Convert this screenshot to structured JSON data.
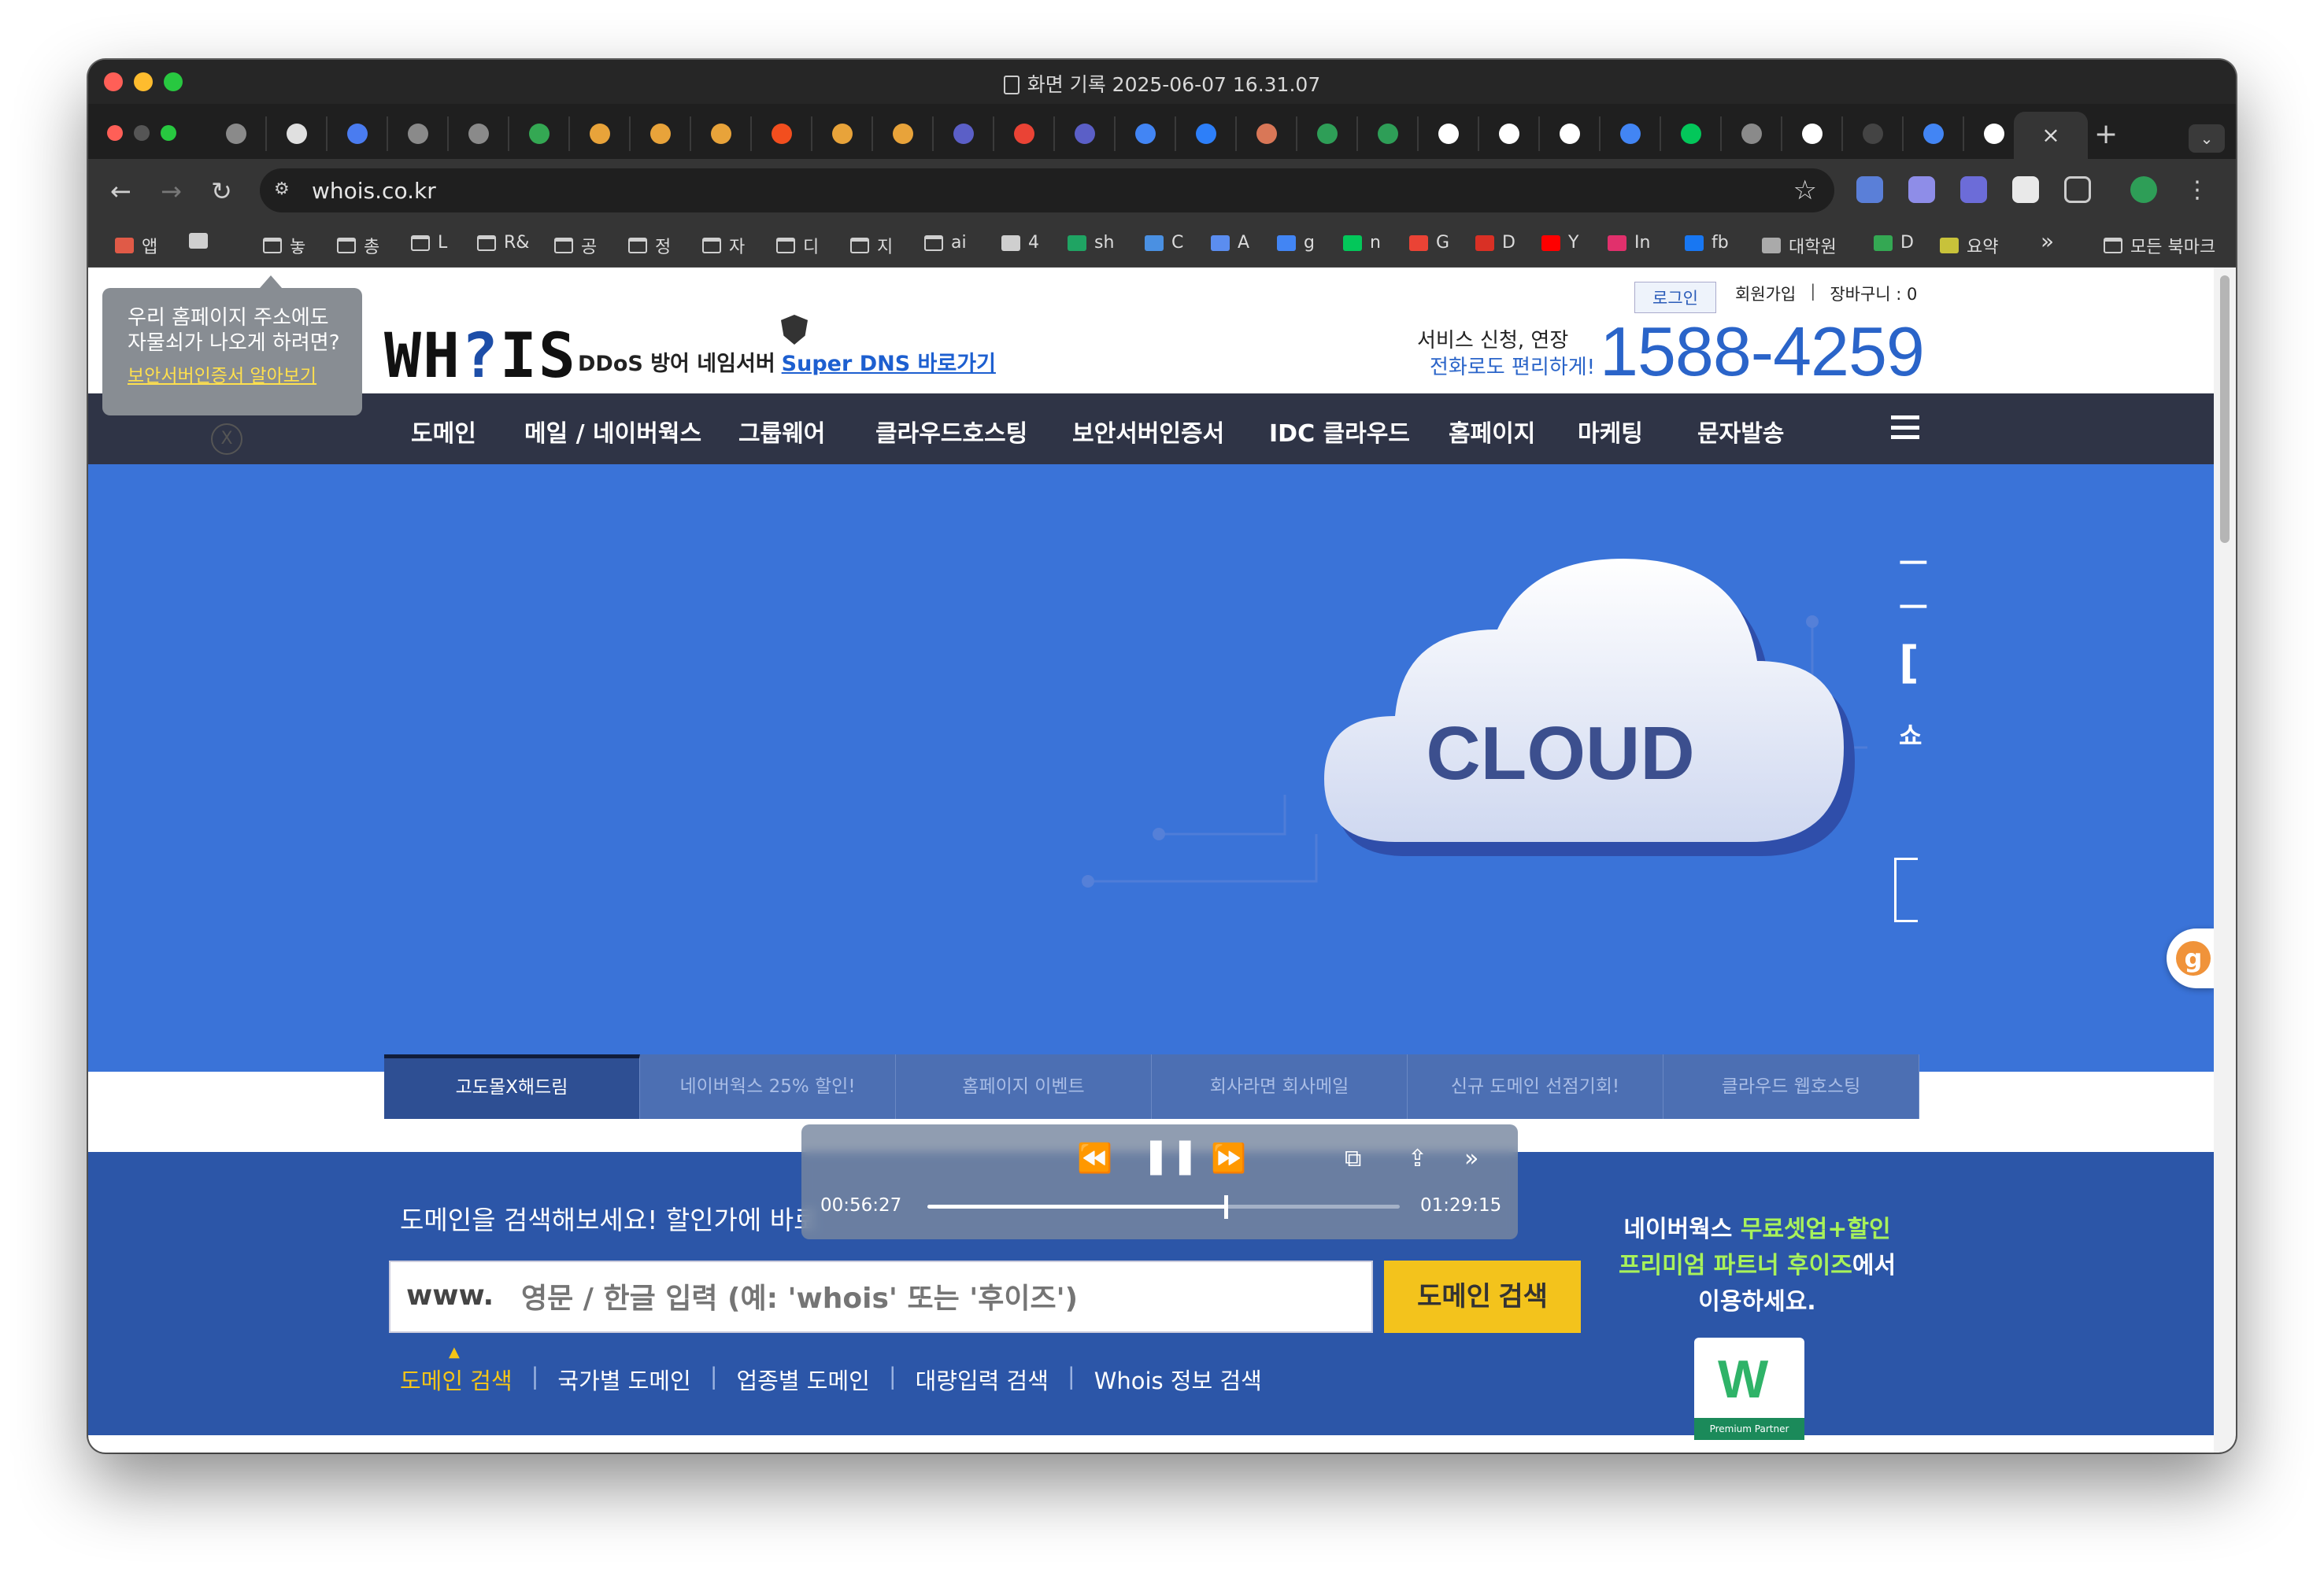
{
  "window": {
    "title": "화면 기록 2025-06-07 16.31.07"
  },
  "tabs": {
    "favicons": [
      {
        "icon": "globe-icon",
        "color": "#8a8a8a"
      },
      {
        "icon": "openai-icon",
        "color": "#e0e0e0"
      },
      {
        "icon": "ring-icon",
        "color": "#4a7cf0"
      },
      {
        "icon": "globe-icon",
        "color": "#8a8a8a"
      },
      {
        "icon": "globe-icon",
        "color": "#8a8a8a"
      },
      {
        "icon": "google-drive-icon",
        "color": "#34a853"
      },
      {
        "icon": "infinity-icon",
        "color": "#e8a33a"
      },
      {
        "icon": "infinity-icon",
        "color": "#e8a33a"
      },
      {
        "icon": "infinity-icon",
        "color": "#e8a33a"
      },
      {
        "icon": "figma-icon",
        "color": "#f24e1e"
      },
      {
        "icon": "infinity-icon",
        "color": "#e8a33a"
      },
      {
        "icon": "infinity-icon",
        "color": "#e8a33a"
      },
      {
        "icon": "slack-icon",
        "color": "#5b5fc7"
      },
      {
        "icon": "gmail-icon",
        "color": "#ea4335"
      },
      {
        "icon": "slack-icon",
        "color": "#5b5fc7"
      },
      {
        "icon": "google-icon",
        "color": "#4285f4"
      },
      {
        "icon": "butterfly-icon",
        "color": "#2d7ff9"
      },
      {
        "icon": "sparkle-icon",
        "color": "#d97757"
      },
      {
        "icon": "leaf-icon",
        "color": "#2e9e57"
      },
      {
        "icon": "leaf-icon",
        "color": "#2e9e57"
      },
      {
        "icon": "github-icon",
        "color": "#ffffff"
      },
      {
        "icon": "github-icon",
        "color": "#ffffff"
      },
      {
        "icon": "cursor-icon",
        "color": "#ffffff"
      },
      {
        "icon": "google-icon",
        "color": "#4285f4"
      },
      {
        "icon": "naver-icon",
        "color": "#03c75a"
      },
      {
        "icon": "globe-icon",
        "color": "#8a8a8a"
      },
      {
        "icon": "vercel-icon",
        "color": "#ffffff"
      },
      {
        "icon": "loading-icon",
        "color": "#444444"
      },
      {
        "icon": "google-icon",
        "color": "#4285f4"
      },
      {
        "icon": "github-icon",
        "color": "#ffffff"
      }
    ],
    "active_close": "×",
    "new_tab": "+"
  },
  "toolbar": {
    "back": "←",
    "forward": "→",
    "reload": "↻",
    "url": "whois.co.kr",
    "star": "☆"
  },
  "bookmarks": [
    {
      "label": "앱",
      "icon": "apps-icon"
    },
    {
      "label": "",
      "icon": "grid-icon"
    },
    {
      "label": "놓",
      "icon": "folder-icon"
    },
    {
      "label": "총",
      "icon": "folder-icon"
    },
    {
      "label": "L",
      "icon": "folder-icon"
    },
    {
      "label": "R&",
      "icon": "folder-icon"
    },
    {
      "label": "공",
      "icon": "folder-icon"
    },
    {
      "label": "정",
      "icon": "folder-icon"
    },
    {
      "label": "자",
      "icon": "folder-icon"
    },
    {
      "label": "디",
      "icon": "folder-icon"
    },
    {
      "label": "지",
      "icon": "folder-icon"
    },
    {
      "label": "ai",
      "icon": "folder-icon"
    },
    {
      "label": "4",
      "icon": "openai-icon"
    },
    {
      "label": "sh",
      "icon": "sheets-icon"
    },
    {
      "label": "C",
      "icon": "image-icon"
    },
    {
      "label": "A",
      "icon": "a-icon"
    },
    {
      "label": "g",
      "icon": "google-icon"
    },
    {
      "label": "n",
      "icon": "naver-icon"
    },
    {
      "label": "G",
      "icon": "gmail-icon"
    },
    {
      "label": "D",
      "icon": "calendar-icon"
    },
    {
      "label": "Y",
      "icon": "youtube-icon"
    },
    {
      "label": "In",
      "icon": "instagram-icon"
    },
    {
      "label": "fb",
      "icon": "facebook-icon"
    },
    {
      "label": "대학원",
      "icon": "globe-icon"
    },
    {
      "label": "D",
      "icon": "google-drive-icon"
    },
    {
      "label": "요약",
      "icon": "summary-icon"
    }
  ],
  "bookmarks_more": "»",
  "bookmarks_all": "모든 북마크",
  "site": {
    "tooltip": {
      "line1": "우리 홈페이지 주소에도",
      "line2": "자물쇠가 나오게 하려면?",
      "link": "보안서버인증서 알아보기",
      "close": "X"
    },
    "logo_pre": "WH",
    "logo_q": "?",
    "logo_post": "IS",
    "tagline": "DDoS 방어 네임서버",
    "tagline_link": "Super DNS 바로가기",
    "topnav": {
      "login": "로그인",
      "join": "회원가입",
      "cart": "장바구니 : 0"
    },
    "service_line1": "서비스 신청, 연장",
    "service_line2": "전화로도 편리하게!",
    "phone": "1588-4259",
    "gnb": [
      "도메인",
      "메일 / 네이버웍스",
      "그룹웨어",
      "클라우드호스팅",
      "보안서버인증서",
      "IDC 클라우드",
      "홈페이지",
      "마케팅",
      "문자발송"
    ],
    "hero": {
      "cloud_text": "CLOUD",
      "side_glyphs": [
        "ㅡ",
        "ㅡ",
        "[",
        "쇼"
      ]
    },
    "hero_tabs": [
      "고도몰X해드림",
      "네이버웍스 25% 할인!",
      "홈페이지 이벤트",
      "회사라면 회사메일",
      "신규 도메인 선점기회!",
      "클라우드 웹호스팅"
    ],
    "search": {
      "title": "도메인을 검색해보세요! 할인가에 바로",
      "prefix": "www.",
      "placeholder": "영문 / 한글 입력 (예: 'whois' 또는 '후이즈')",
      "button": "도메인 검색",
      "links": [
        "도메인 검색",
        "국가별 도메인",
        "업종별 도메인",
        "대량입력 검색",
        "Whois 정보 검색"
      ]
    },
    "promo": {
      "line1_a": "네이버웍스 ",
      "line1_b": "무료셋업+할인",
      "line2_a": "프리미엄 파트너 후이즈",
      "line2_b": "에서",
      "line3": "이용하세요.",
      "badge_letter": "W",
      "badge_caption": "Premium Partner"
    },
    "float_badge": "g"
  },
  "media": {
    "elapsed": "00:56:27",
    "total": "01:29:15",
    "progress": 0.632
  }
}
